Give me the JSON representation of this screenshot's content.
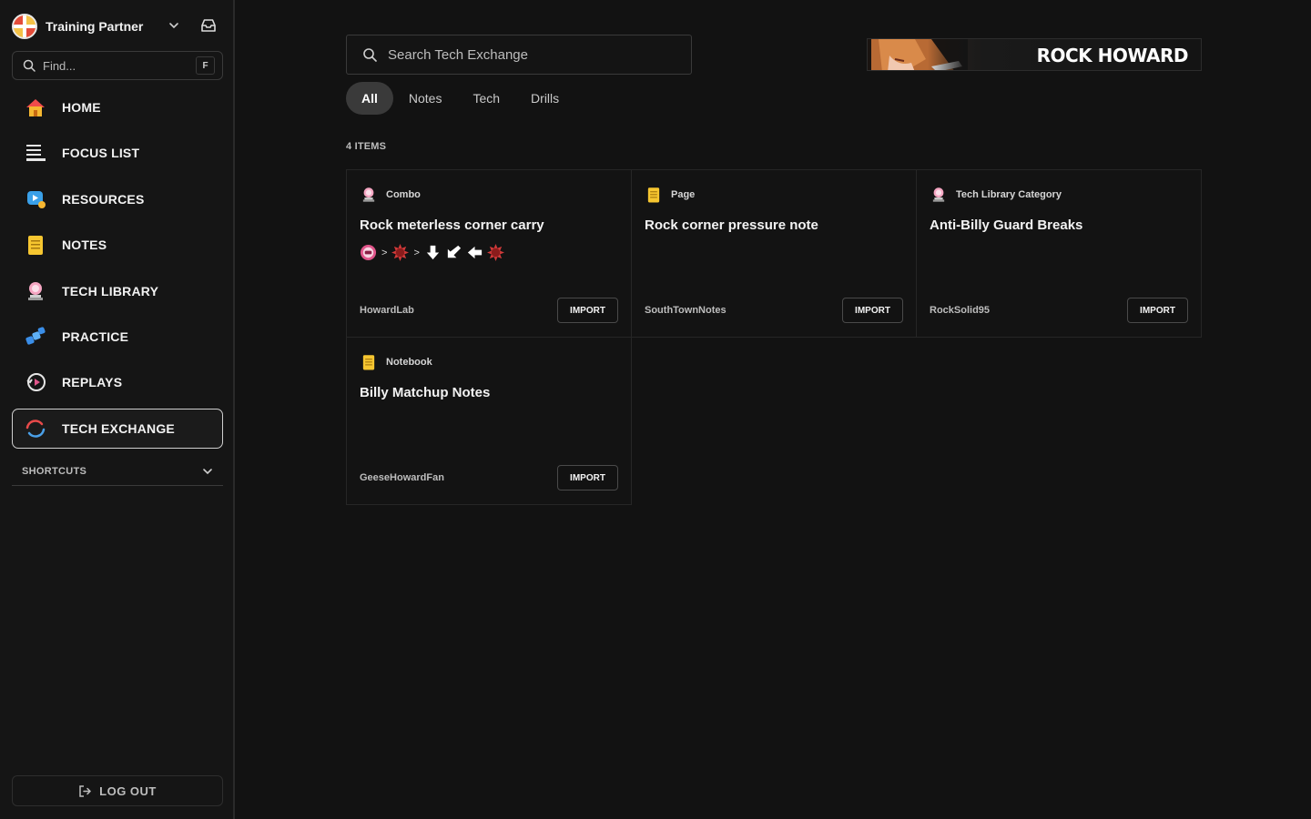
{
  "sidebar": {
    "workspace_name": "Training Partner",
    "find": {
      "placeholder": "Find...",
      "shortcut": "F"
    },
    "nav": [
      {
        "label": "HOME",
        "icon": "home-icon"
      },
      {
        "label": "FOCUS LIST",
        "icon": "list-icon"
      },
      {
        "label": "RESOURCES",
        "icon": "resources-icon"
      },
      {
        "label": "NOTES",
        "icon": "notepad-icon"
      },
      {
        "label": "TECH LIBRARY",
        "icon": "tech-library-icon"
      },
      {
        "label": "PRACTICE",
        "icon": "practice-icon"
      },
      {
        "label": "REPLAYS",
        "icon": "replay-icon"
      },
      {
        "label": "TECH EXCHANGE",
        "icon": "exchange-icon",
        "active": true
      }
    ],
    "shortcuts_label": "SHORTCUTS",
    "logout_label": "LOG OUT"
  },
  "main": {
    "search_placeholder": "Search Tech Exchange",
    "banner_title": "ROCK HOWARD",
    "tabs": [
      {
        "label": "All",
        "active": true
      },
      {
        "label": "Notes"
      },
      {
        "label": "Tech"
      },
      {
        "label": "Drills"
      }
    ],
    "item_count": "4 ITEMS",
    "cards": [
      {
        "type": "Combo",
        "type_icon": "tech-library-icon",
        "title": "Rock meterless corner carry",
        "author": "HowardLab",
        "button": "IMPORT",
        "combo": [
          "crouch-punch-icon",
          ">",
          "burst-icon",
          ">",
          "arrow-down-icon",
          "arrow-down-left-icon",
          "arrow-left-icon",
          "burst-icon"
        ]
      },
      {
        "type": "Page",
        "type_icon": "notepad-icon",
        "title": "Rock corner pressure note",
        "author": "SouthTownNotes",
        "button": "IMPORT"
      },
      {
        "type": "Tech Library Category",
        "type_icon": "tech-library-icon",
        "title": "Anti-Billy Guard Breaks",
        "author": "RockSolid95",
        "button": "IMPORT"
      },
      {
        "type": "Notebook",
        "type_icon": "notepad-icon",
        "title": "Billy Matchup Notes",
        "author": "GeeseHowardFan",
        "button": "IMPORT"
      }
    ]
  },
  "colors": {
    "background": "#121212",
    "sidebar": "#151515",
    "accent_active_tab": "#3a3a3a",
    "border": "#262626"
  }
}
